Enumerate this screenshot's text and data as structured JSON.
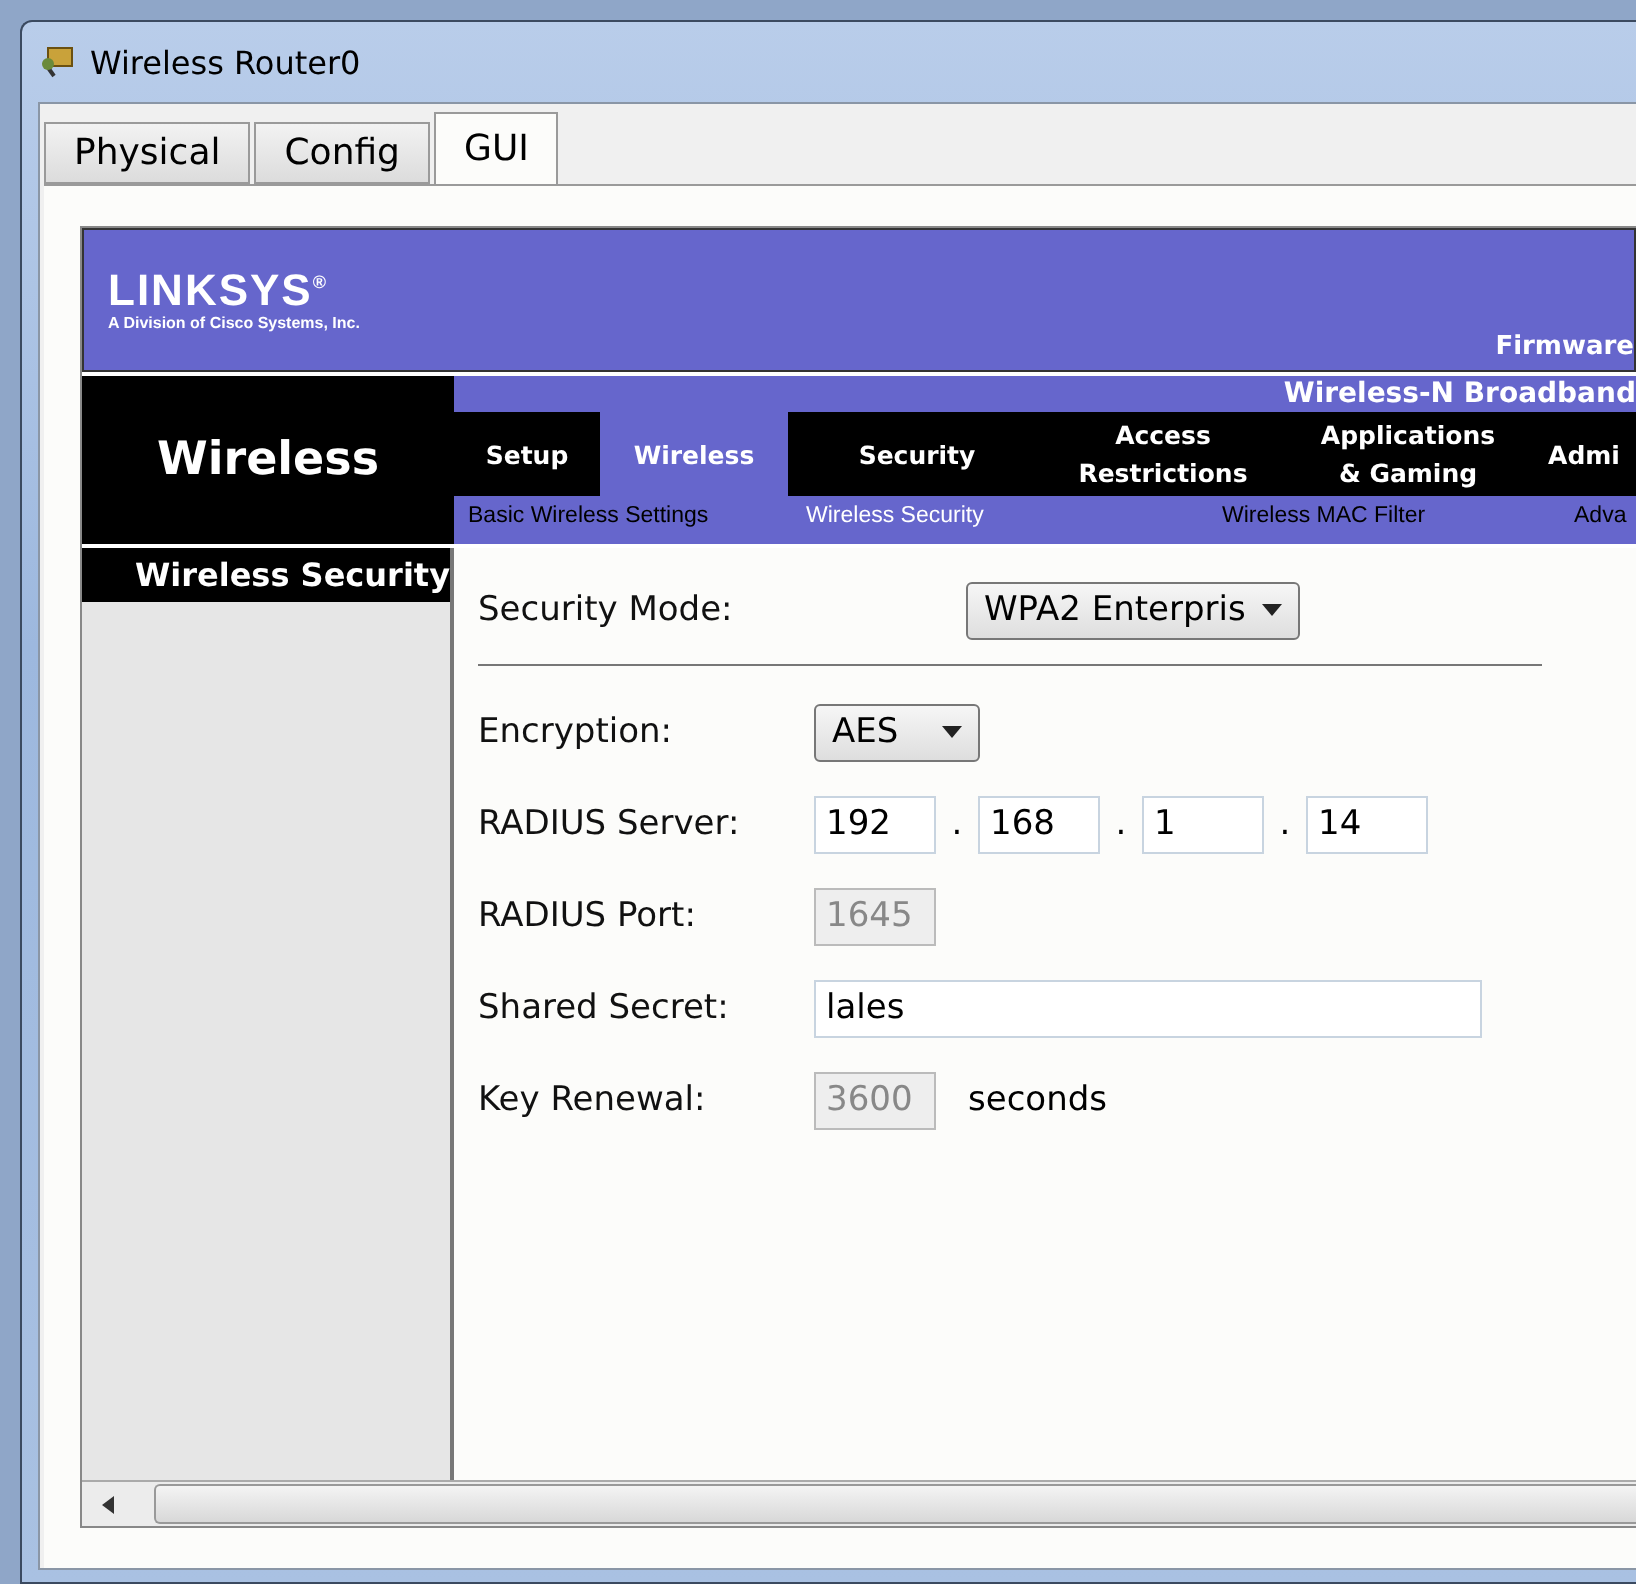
{
  "window": {
    "title": "Wireless Router0"
  },
  "tabs": [
    {
      "label": "Physical",
      "selected": false
    },
    {
      "label": "Config",
      "selected": false
    },
    {
      "label": "GUI",
      "selected": true
    }
  ],
  "router_page": {
    "logo": {
      "brand": "LINKSYS",
      "mark": "®",
      "subtitle": "A Division of Cisco Systems, Inc."
    },
    "firmware": "Firmware",
    "product": "Wireless-N Broadband",
    "section": "Wireless",
    "nav_tabs": [
      {
        "label": "Setup",
        "selected": false
      },
      {
        "label": "Wireless",
        "selected": true
      },
      {
        "label": "Security",
        "selected": false
      },
      {
        "label": "Access Restrictions",
        "selected": false
      },
      {
        "label": "Applications & Gaming",
        "selected": false
      },
      {
        "label": "Admi",
        "selected": false
      }
    ],
    "sub_tabs": [
      {
        "label": "Basic Wireless Settings",
        "selected": false
      },
      {
        "label": "Wireless Security",
        "selected": true
      },
      {
        "label": "Wireless MAC Filter",
        "selected": false
      },
      {
        "label": "Adva",
        "selected": false
      }
    ],
    "side_title": "Wireless Security",
    "fields": [
      {
        "kind": "select",
        "label": "Security Mode:",
        "value": "WPA2 Enterpris"
      },
      {
        "kind": "divider"
      },
      {
        "kind": "select",
        "label": "Encryption:",
        "value": "AES"
      },
      {
        "kind": "ip",
        "label": "RADIUS Server:",
        "parts": [
          "192",
          "168",
          "1",
          "14"
        ],
        "separator": "."
      },
      {
        "kind": "text",
        "label": "RADIUS Port:",
        "value": "1645",
        "disabled": true
      },
      {
        "kind": "wide_text",
        "label": "Shared Secret:",
        "value": "lales",
        "disabled": false
      },
      {
        "kind": "text",
        "label": "Key Renewal:",
        "value": "3600",
        "disabled": true,
        "suffix": "seconds"
      }
    ]
  }
}
